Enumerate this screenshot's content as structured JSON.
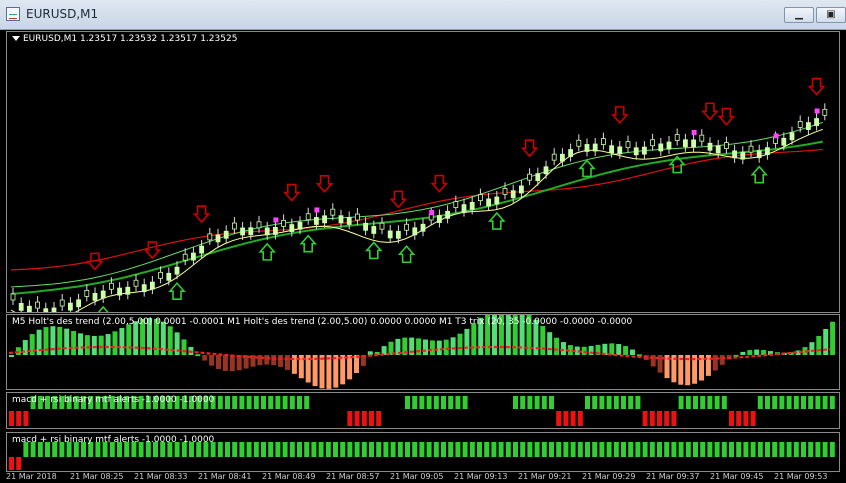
{
  "window": {
    "title": "EURUSD,M1"
  },
  "main_chart": {
    "header": "EURUSD,M1  1.23517 1.23532 1.23517 1.23525"
  },
  "indicator1": {
    "label": "M5 Holt's des trend (2.00,5.00)  0.0001 -0.0001  M1 Holt's des trend (2.00,5.00) 0.0000 0.0000  M1 T3 trix (20, 35 -0.0000 -0.0000 -0.0000"
  },
  "indicator2": {
    "label": "macd + rsi binary mtf alerts -1.0000 -1.0000"
  },
  "indicator3": {
    "label": "macd + rsi binary mtf alerts -1.0000 -1.0000"
  },
  "time_axis": {
    "labels": [
      "21 Mar 2018",
      "21 Mar 08:25",
      "21 Mar 08:33",
      "21 Mar 08:41",
      "21 Mar 08:49",
      "21 Mar 08:57",
      "21 Mar 09:05",
      "21 Mar 09:13",
      "21 Mar 09:21",
      "21 Mar 09:29",
      "21 Mar 09:37",
      "21 Mar 09:45",
      "21 Mar 09:53"
    ]
  },
  "colors": {
    "bull_candle": "#ccffaa",
    "sell_arrow": "#cc0000",
    "buy_arrow": "#33cc33",
    "ma_yellow": "#ffff99",
    "ma_green": "#22aa22",
    "ma_red": "#dd1111",
    "bar_green": "#33cc33",
    "bar_red": "#cc2222"
  }
}
